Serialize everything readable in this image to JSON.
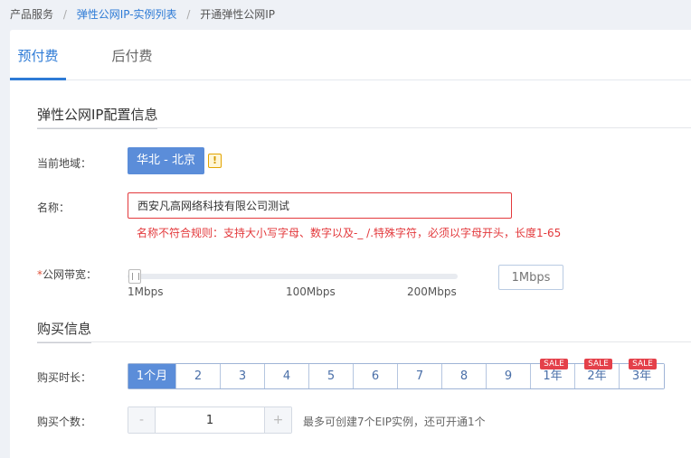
{
  "breadcrumb": [
    "产品服务",
    "弹性公网IP-实例列表",
    "开通弹性公网IP"
  ],
  "breadcrumb_sep": "/",
  "tabs": [
    {
      "label": "预付费",
      "active": true
    },
    {
      "label": "后付费",
      "active": false
    }
  ],
  "config_section": {
    "title": "弹性公网IP配置信息",
    "region_label": "当前地域：",
    "region_value": "华北 - 北京",
    "warning_glyph": "!",
    "name_label": "名称：",
    "name_value": "西安凡高网络科技有限公司测试",
    "name_error": "名称不符合规则：支持大小写字母、数字以及-_ /.特殊字符，必须以字母开头，长度1-65",
    "bandwidth_required_mark": "*",
    "bandwidth_label": "公网带宽：",
    "bandwidth_level": 0,
    "bandwidth_ticks": [
      "1Mbps",
      "100Mbps",
      "200Mbps"
    ],
    "bandwidth_input_placeholder": "1Mbps"
  },
  "purchase_section": {
    "title": "购买信息",
    "duration_label": "购买时长：",
    "durations": [
      {
        "label": "1个月",
        "active": true,
        "sale": ""
      },
      {
        "label": "2",
        "active": false,
        "sale": ""
      },
      {
        "label": "3",
        "active": false,
        "sale": ""
      },
      {
        "label": "4",
        "active": false,
        "sale": ""
      },
      {
        "label": "5",
        "active": false,
        "sale": ""
      },
      {
        "label": "6",
        "active": false,
        "sale": ""
      },
      {
        "label": "7",
        "active": false,
        "sale": ""
      },
      {
        "label": "8",
        "active": false,
        "sale": ""
      },
      {
        "label": "9",
        "active": false,
        "sale": ""
      },
      {
        "label": "1年",
        "active": false,
        "sale": "SALE"
      },
      {
        "label": "2年",
        "active": false,
        "sale": "SALE"
      },
      {
        "label": "3年",
        "active": false,
        "sale": "SALE"
      }
    ],
    "quantity_label": "购买个数：",
    "quantity_minus": "-",
    "quantity_value": "1",
    "quantity_plus": "+",
    "quantity_hint": "最多可创建7个EIP实例，还可开通1个"
  },
  "colors": {
    "accent": "#2e7bd6",
    "active_fill": "#5b8dd9",
    "error": "#e3393c",
    "sale": "#e4404a"
  },
  "icons": {
    "region_warning": "warning-icon",
    "slider": "slider-handle-icon"
  }
}
